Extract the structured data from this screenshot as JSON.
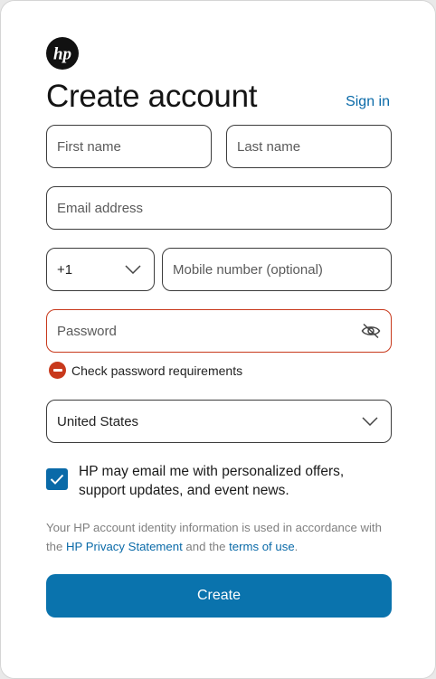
{
  "header": {
    "logo_text": "hp",
    "title": "Create account",
    "signin_label": "Sign in"
  },
  "form": {
    "first_name": {
      "placeholder": "First name",
      "value": ""
    },
    "last_name": {
      "placeholder": "Last name",
      "value": ""
    },
    "email": {
      "placeholder": "Email address",
      "value": ""
    },
    "country_code": {
      "value": "+1"
    },
    "mobile": {
      "placeholder": "Mobile number (optional)",
      "value": ""
    },
    "password": {
      "placeholder": "Password",
      "value": "",
      "error": "Check password requirements"
    },
    "country": {
      "value": "United States"
    },
    "consent": {
      "checked": true,
      "label": "HP may email me with personalized offers, support updates, and event news."
    },
    "legal": {
      "prefix": "Your HP account identity information is used in accordance with the ",
      "privacy_link": "HP Privacy Statement",
      "middle": " and the ",
      "terms_link": "terms of use",
      "suffix": "."
    },
    "submit_label": "Create"
  },
  "icons": {
    "logo": "hp-logo-icon",
    "dropdown": "chevron-down-icon",
    "password_toggle": "eye-slash-icon",
    "error": "error-icon",
    "check": "checkmark-icon"
  },
  "colors": {
    "accent": "#0a73ad",
    "link": "#0a6aa8",
    "error": "#c8391c"
  }
}
